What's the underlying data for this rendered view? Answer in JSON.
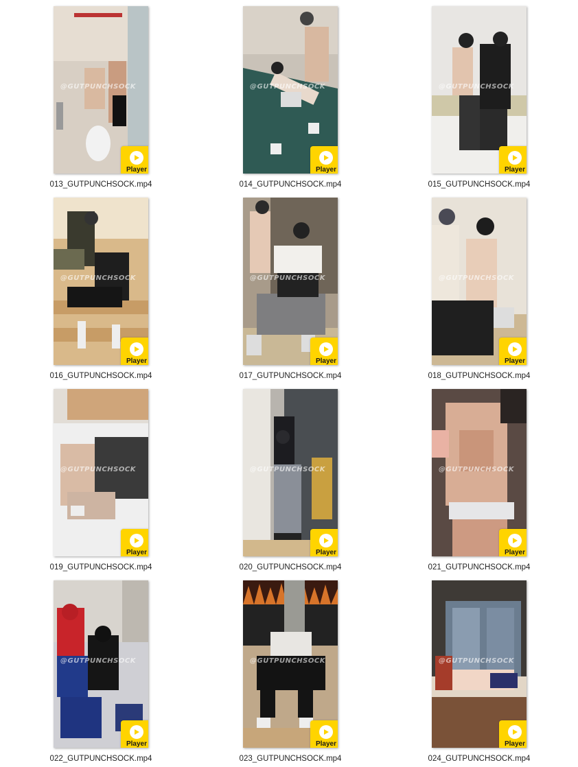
{
  "player_label": "Player",
  "watermark": "@GUTPUNCHSOCK",
  "files": [
    {
      "name": "013_GUTPUNCHSOCK.mp4",
      "scene": "bathroom"
    },
    {
      "name": "014_GUTPUNCHSOCK.mp4",
      "scene": "green-couch"
    },
    {
      "name": "015_GUTPUNCHSOCK.mp4",
      "scene": "bench"
    },
    {
      "name": "016_GUTPUNCHSOCK.mp4",
      "scene": "stairs"
    },
    {
      "name": "017_GUTPUNCHSOCK.mp4",
      "scene": "armchair"
    },
    {
      "name": "018_GUTPUNCHSOCK.mp4",
      "scene": "floor-lean"
    },
    {
      "name": "019_GUTPUNCHSOCK.mp4",
      "scene": "bed"
    },
    {
      "name": "020_GUTPUNCHSOCK.mp4",
      "scene": "curtain"
    },
    {
      "name": "021_GUTPUNCHSOCK.mp4",
      "scene": "closeup"
    },
    {
      "name": "022_GUTPUNCHSOCK.mp4",
      "scene": "costume"
    },
    {
      "name": "023_GUTPUNCHSOCK.mp4",
      "scene": "flames-wall"
    },
    {
      "name": "024_GUTPUNCHSOCK.mp4",
      "scene": "window-night"
    }
  ],
  "colors": {
    "badge": "#ffd400",
    "play_arrow": "#ffd400"
  },
  "icons": {
    "play": "play-icon"
  }
}
